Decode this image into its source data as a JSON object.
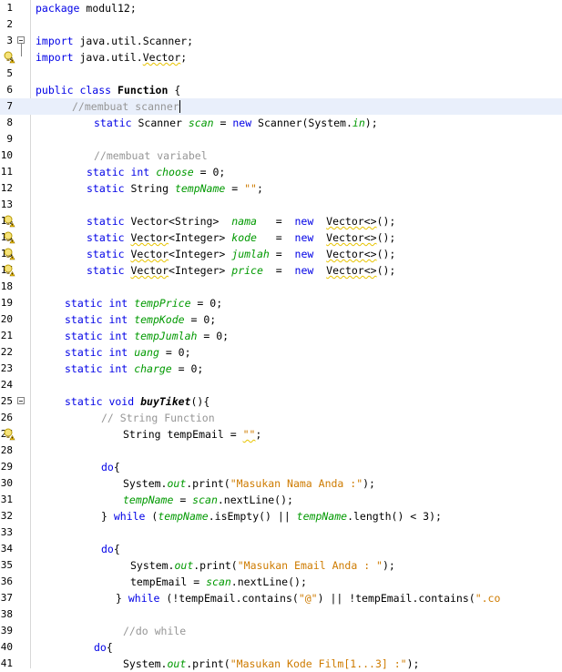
{
  "lines": [
    {
      "n": "1",
      "indent": 0,
      "t": [
        [
          "kw",
          "package"
        ],
        [
          "p",
          " modul12;"
        ]
      ]
    },
    {
      "n": "2",
      "indent": 0,
      "t": []
    },
    {
      "n": "3",
      "indent": 0,
      "fold": true,
      "t": [
        [
          "kw",
          "import"
        ],
        [
          "p",
          " java.util.Scanner;"
        ]
      ]
    },
    {
      "n": "4",
      "indent": 0,
      "hint": true,
      "t": [
        [
          "kw",
          "import"
        ],
        [
          "p",
          " java.util."
        ],
        [
          "w",
          "Vector"
        ],
        [
          "p",
          ";"
        ]
      ]
    },
    {
      "n": "5",
      "indent": 0,
      "t": []
    },
    {
      "n": "6",
      "indent": 0,
      "t": [
        [
          "kw",
          "public class"
        ],
        [
          "b",
          " Function"
        ],
        [
          "p",
          " {"
        ]
      ]
    },
    {
      "n": "7",
      "indent": 5,
      "current": true,
      "t": [
        [
          "cm",
          "//membuat scanner"
        ],
        [
          "caret",
          ""
        ]
      ]
    },
    {
      "n": "8",
      "indent": 8,
      "t": [
        [
          "kw",
          "static"
        ],
        [
          "p",
          " Scanner "
        ],
        [
          "fd",
          "scan"
        ],
        [
          "p",
          " = "
        ],
        [
          "kw",
          "new"
        ],
        [
          "p",
          " Scanner(System."
        ],
        [
          "fd",
          "in"
        ],
        [
          "p",
          ");"
        ]
      ]
    },
    {
      "n": "9",
      "indent": 0,
      "t": []
    },
    {
      "n": "10",
      "indent": 8,
      "t": [
        [
          "cm",
          "//membuat variabel"
        ]
      ]
    },
    {
      "n": "11",
      "indent": 7,
      "t": [
        [
          "kw",
          "static int"
        ],
        [
          "p",
          " "
        ],
        [
          "fd",
          "choose"
        ],
        [
          "p",
          " = 0;"
        ]
      ]
    },
    {
      "n": "12",
      "indent": 7,
      "t": [
        [
          "kw",
          "static"
        ],
        [
          "p",
          " String "
        ],
        [
          "fd",
          "tempName"
        ],
        [
          "p",
          " = "
        ],
        [
          "st",
          "\"\""
        ],
        [
          "p",
          ";"
        ]
      ]
    },
    {
      "n": "13",
      "indent": 0,
      "t": []
    },
    {
      "n": "14",
      "indent": 7,
      "hint": true,
      "t": [
        [
          "kw",
          "static"
        ],
        [
          "p",
          " Vector<String>  "
        ],
        [
          "fd",
          "nama"
        ],
        [
          "p",
          "   =  "
        ],
        [
          "kw",
          "new"
        ],
        [
          "p",
          "  "
        ],
        [
          "w",
          "Vector<>"
        ],
        [
          "p",
          "();"
        ]
      ]
    },
    {
      "n": "15",
      "indent": 7,
      "hint": true,
      "t": [
        [
          "kw",
          "static"
        ],
        [
          "p",
          " "
        ],
        [
          "w",
          "Vector"
        ],
        [
          "p",
          "<Integer> "
        ],
        [
          "fd",
          "kode"
        ],
        [
          "p",
          "   =  "
        ],
        [
          "kw",
          "new"
        ],
        [
          "p",
          "  "
        ],
        [
          "w",
          "Vector<>"
        ],
        [
          "p",
          "();"
        ]
      ]
    },
    {
      "n": "16",
      "indent": 7,
      "hint": true,
      "t": [
        [
          "kw",
          "static"
        ],
        [
          "p",
          " "
        ],
        [
          "w",
          "Vector"
        ],
        [
          "p",
          "<Integer> "
        ],
        [
          "fd",
          "jumlah"
        ],
        [
          "p",
          " =  "
        ],
        [
          "kw",
          "new"
        ],
        [
          "p",
          "  "
        ],
        [
          "w",
          "Vector<>"
        ],
        [
          "p",
          "();"
        ]
      ]
    },
    {
      "n": "17",
      "indent": 7,
      "hint": true,
      "t": [
        [
          "kw",
          "static"
        ],
        [
          "p",
          " "
        ],
        [
          "w",
          "Vector"
        ],
        [
          "p",
          "<Integer> "
        ],
        [
          "fd",
          "price"
        ],
        [
          "p",
          "  =  "
        ],
        [
          "kw",
          "new"
        ],
        [
          "p",
          "  "
        ],
        [
          "w",
          "Vector<>"
        ],
        [
          "p",
          "();"
        ]
      ]
    },
    {
      "n": "18",
      "indent": 0,
      "t": []
    },
    {
      "n": "19",
      "indent": 4,
      "t": [
        [
          "kw",
          "static int"
        ],
        [
          "p",
          " "
        ],
        [
          "fd",
          "tempPrice"
        ],
        [
          "p",
          " = 0;"
        ]
      ]
    },
    {
      "n": "20",
      "indent": 4,
      "t": [
        [
          "kw",
          "static int"
        ],
        [
          "p",
          " "
        ],
        [
          "fd",
          "tempKode"
        ],
        [
          "p",
          " = 0;"
        ]
      ]
    },
    {
      "n": "21",
      "indent": 4,
      "t": [
        [
          "kw",
          "static int"
        ],
        [
          "p",
          " "
        ],
        [
          "fd",
          "tempJumlah"
        ],
        [
          "p",
          " = 0;"
        ]
      ]
    },
    {
      "n": "22",
      "indent": 4,
      "t": [
        [
          "kw",
          "static int"
        ],
        [
          "p",
          " "
        ],
        [
          "fd",
          "uang"
        ],
        [
          "p",
          " = 0;"
        ]
      ]
    },
    {
      "n": "23",
      "indent": 4,
      "t": [
        [
          "kw",
          "static int"
        ],
        [
          "p",
          " "
        ],
        [
          "fd",
          "charge"
        ],
        [
          "p",
          " = 0;"
        ]
      ]
    },
    {
      "n": "24",
      "indent": 0,
      "t": []
    },
    {
      "n": "25",
      "indent": 4,
      "fold": true,
      "t": [
        [
          "kw",
          "static void"
        ],
        [
          "bi",
          " buyTiket"
        ],
        [
          "p",
          "(){"
        ]
      ]
    },
    {
      "n": "26",
      "indent": 9,
      "t": [
        [
          "cm",
          "// String Function"
        ]
      ]
    },
    {
      "n": "27",
      "indent": 12,
      "hint": true,
      "t": [
        [
          "p",
          "String tempEmail = "
        ],
        [
          "ws",
          "\"\""
        ],
        [
          "p",
          ";"
        ]
      ]
    },
    {
      "n": "28",
      "indent": 0,
      "t": []
    },
    {
      "n": "29",
      "indent": 9,
      "t": [
        [
          "kw",
          "do"
        ],
        [
          "p",
          "{"
        ]
      ]
    },
    {
      "n": "30",
      "indent": 12,
      "t": [
        [
          "p",
          "System."
        ],
        [
          "fd",
          "out"
        ],
        [
          "p",
          ".print("
        ],
        [
          "st",
          "\"Masukan Nama Anda :\""
        ],
        [
          "p",
          ");"
        ]
      ]
    },
    {
      "n": "31",
      "indent": 12,
      "t": [
        [
          "fd",
          "tempName"
        ],
        [
          "p",
          " = "
        ],
        [
          "fd",
          "scan"
        ],
        [
          "p",
          ".nextLine();"
        ]
      ]
    },
    {
      "n": "32",
      "indent": 9,
      "t": [
        [
          "p",
          "} "
        ],
        [
          "kw",
          "while"
        ],
        [
          "p",
          " ("
        ],
        [
          "fd",
          "tempName"
        ],
        [
          "p",
          ".isEmpty() || "
        ],
        [
          "fd",
          "tempName"
        ],
        [
          "p",
          ".length() < 3);"
        ]
      ]
    },
    {
      "n": "33",
      "indent": 0,
      "t": []
    },
    {
      "n": "34",
      "indent": 9,
      "t": [
        [
          "kw",
          "do"
        ],
        [
          "p",
          "{"
        ]
      ]
    },
    {
      "n": "35",
      "indent": 13,
      "t": [
        [
          "p",
          "System."
        ],
        [
          "fd",
          "out"
        ],
        [
          "p",
          ".print("
        ],
        [
          "st",
          "\"Masukan Email Anda : \""
        ],
        [
          "p",
          ");"
        ]
      ]
    },
    {
      "n": "36",
      "indent": 13,
      "t": [
        [
          "p",
          "tempEmail = "
        ],
        [
          "fd",
          "scan"
        ],
        [
          "p",
          ".nextLine();"
        ]
      ]
    },
    {
      "n": "37",
      "indent": 11,
      "t": [
        [
          "p",
          "} "
        ],
        [
          "kw",
          "while"
        ],
        [
          "p",
          " (!tempEmail.contains("
        ],
        [
          "st",
          "\"@\""
        ],
        [
          "p",
          ") || !tempEmail.contains("
        ],
        [
          "st",
          "\".co"
        ]
      ]
    },
    {
      "n": "38",
      "indent": 0,
      "t": []
    },
    {
      "n": "39",
      "indent": 12,
      "t": [
        [
          "cm",
          "//do while"
        ]
      ]
    },
    {
      "n": "40",
      "indent": 8,
      "t": [
        [
          "kw",
          "do"
        ],
        [
          "p",
          "{"
        ]
      ]
    },
    {
      "n": "41",
      "indent": 12,
      "t": [
        [
          "p",
          "System."
        ],
        [
          "fd",
          "out"
        ],
        [
          "p",
          ".print("
        ],
        [
          "st",
          "\"Masukan Kode Film[1...3] :\""
        ],
        [
          "p",
          ");"
        ]
      ]
    }
  ]
}
